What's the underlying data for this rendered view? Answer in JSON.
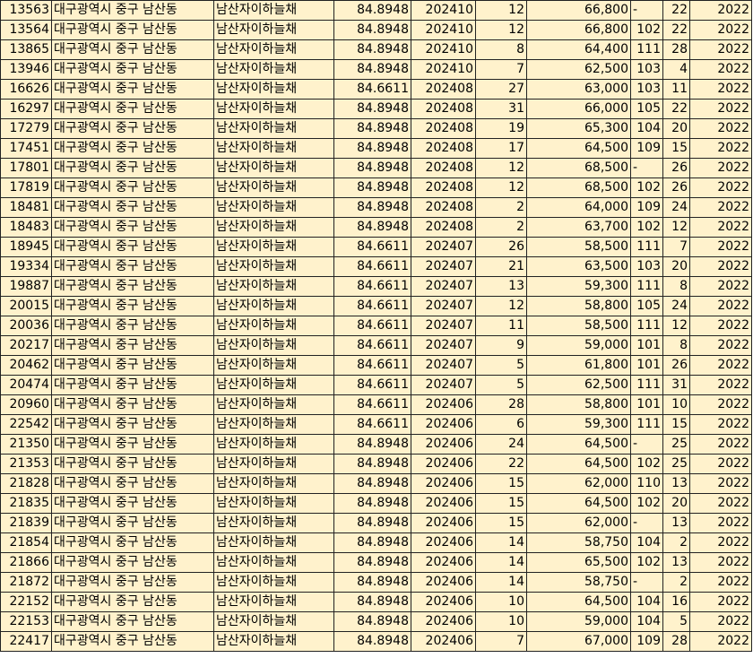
{
  "sheet": {
    "colors": {
      "cell_fill": "#fff2cc",
      "gridline": "#222222",
      "text": "#000000"
    },
    "rows": [
      [
        "13563",
        "대구광역시 중구 남산동",
        "남산자이하늘채",
        "84.8948",
        "202410",
        "12",
        "66,800",
        "-",
        "22",
        "2022"
      ],
      [
        "13564",
        "대구광역시 중구 남산동",
        "남산자이하늘채",
        "84.8948",
        "202410",
        "12",
        "66,800",
        "102",
        "22",
        "2022"
      ],
      [
        "13865",
        "대구광역시 중구 남산동",
        "남산자이하늘채",
        "84.8948",
        "202410",
        "8",
        "64,400",
        "111",
        "28",
        "2022"
      ],
      [
        "13946",
        "대구광역시 중구 남산동",
        "남산자이하늘채",
        "84.8948",
        "202410",
        "7",
        "62,500",
        "103",
        "4",
        "2022"
      ],
      [
        "16626",
        "대구광역시 중구 남산동",
        "남산자이하늘채",
        "84.6611",
        "202408",
        "27",
        "63,000",
        "103",
        "11",
        "2022"
      ],
      [
        "16297",
        "대구광역시 중구 남산동",
        "남산자이하늘채",
        "84.8948",
        "202408",
        "31",
        "66,000",
        "105",
        "22",
        "2022"
      ],
      [
        "17279",
        "대구광역시 중구 남산동",
        "남산자이하늘채",
        "84.8948",
        "202408",
        "19",
        "65,300",
        "104",
        "20",
        "2022"
      ],
      [
        "17451",
        "대구광역시 중구 남산동",
        "남산자이하늘채",
        "84.8948",
        "202408",
        "17",
        "64,500",
        "109",
        "15",
        "2022"
      ],
      [
        "17801",
        "대구광역시 중구 남산동",
        "남산자이하늘채",
        "84.8948",
        "202408",
        "12",
        "68,500",
        "-",
        "26",
        "2022"
      ],
      [
        "17819",
        "대구광역시 중구 남산동",
        "남산자이하늘채",
        "84.8948",
        "202408",
        "12",
        "68,500",
        "102",
        "26",
        "2022"
      ],
      [
        "18481",
        "대구광역시 중구 남산동",
        "남산자이하늘채",
        "84.8948",
        "202408",
        "2",
        "64,000",
        "109",
        "24",
        "2022"
      ],
      [
        "18483",
        "대구광역시 중구 남산동",
        "남산자이하늘채",
        "84.8948",
        "202408",
        "2",
        "63,700",
        "102",
        "12",
        "2022"
      ],
      [
        "18945",
        "대구광역시 중구 남산동",
        "남산자이하늘채",
        "84.6611",
        "202407",
        "26",
        "58,500",
        "111",
        "7",
        "2022"
      ],
      [
        "19334",
        "대구광역시 중구 남산동",
        "남산자이하늘채",
        "84.6611",
        "202407",
        "21",
        "63,500",
        "103",
        "20",
        "2022"
      ],
      [
        "19887",
        "대구광역시 중구 남산동",
        "남산자이하늘채",
        "84.6611",
        "202407",
        "13",
        "59,300",
        "111",
        "8",
        "2022"
      ],
      [
        "20015",
        "대구광역시 중구 남산동",
        "남산자이하늘채",
        "84.6611",
        "202407",
        "12",
        "58,800",
        "105",
        "24",
        "2022"
      ],
      [
        "20036",
        "대구광역시 중구 남산동",
        "남산자이하늘채",
        "84.6611",
        "202407",
        "11",
        "58,500",
        "111",
        "12",
        "2022"
      ],
      [
        "20217",
        "대구광역시 중구 남산동",
        "남산자이하늘채",
        "84.6611",
        "202407",
        "9",
        "59,000",
        "101",
        "8",
        "2022"
      ],
      [
        "20462",
        "대구광역시 중구 남산동",
        "남산자이하늘채",
        "84.6611",
        "202407",
        "5",
        "61,800",
        "101",
        "26",
        "2022"
      ],
      [
        "20474",
        "대구광역시 중구 남산동",
        "남산자이하늘채",
        "84.6611",
        "202407",
        "5",
        "62,500",
        "111",
        "31",
        "2022"
      ],
      [
        "20960",
        "대구광역시 중구 남산동",
        "남산자이하늘채",
        "84.6611",
        "202406",
        "28",
        "58,800",
        "101",
        "10",
        "2022"
      ],
      [
        "22542",
        "대구광역시 중구 남산동",
        "남산자이하늘채",
        "84.6611",
        "202406",
        "6",
        "59,300",
        "111",
        "15",
        "2022"
      ],
      [
        "21350",
        "대구광역시 중구 남산동",
        "남산자이하늘채",
        "84.8948",
        "202406",
        "24",
        "64,500",
        "-",
        "25",
        "2022"
      ],
      [
        "21353",
        "대구광역시 중구 남산동",
        "남산자이하늘채",
        "84.8948",
        "202406",
        "22",
        "64,500",
        "102",
        "25",
        "2022"
      ],
      [
        "21828",
        "대구광역시 중구 남산동",
        "남산자이하늘채",
        "84.8948",
        "202406",
        "15",
        "62,000",
        "110",
        "13",
        "2022"
      ],
      [
        "21835",
        "대구광역시 중구 남산동",
        "남산자이하늘채",
        "84.8948",
        "202406",
        "15",
        "64,500",
        "102",
        "20",
        "2022"
      ],
      [
        "21839",
        "대구광역시 중구 남산동",
        "남산자이하늘채",
        "84.8948",
        "202406",
        "15",
        "62,000",
        "-",
        "13",
        "2022"
      ],
      [
        "21854",
        "대구광역시 중구 남산동",
        "남산자이하늘채",
        "84.8948",
        "202406",
        "14",
        "58,750",
        "104",
        "2",
        "2022"
      ],
      [
        "21866",
        "대구광역시 중구 남산동",
        "남산자이하늘채",
        "84.8948",
        "202406",
        "14",
        "65,500",
        "102",
        "13",
        "2022"
      ],
      [
        "21872",
        "대구광역시 중구 남산동",
        "남산자이하늘채",
        "84.8948",
        "202406",
        "14",
        "58,750",
        "-",
        "2",
        "2022"
      ],
      [
        "22152",
        "대구광역시 중구 남산동",
        "남산자이하늘채",
        "84.8948",
        "202406",
        "10",
        "64,500",
        "104",
        "16",
        "2022"
      ],
      [
        "22153",
        "대구광역시 중구 남산동",
        "남산자이하늘채",
        "84.8948",
        "202406",
        "10",
        "59,000",
        "104",
        "5",
        "2022"
      ],
      [
        "22417",
        "대구광역시 중구 남산동",
        "남산자이하늘채",
        "84.8948",
        "202406",
        "7",
        "67,000",
        "109",
        "28",
        "2022"
      ]
    ]
  }
}
